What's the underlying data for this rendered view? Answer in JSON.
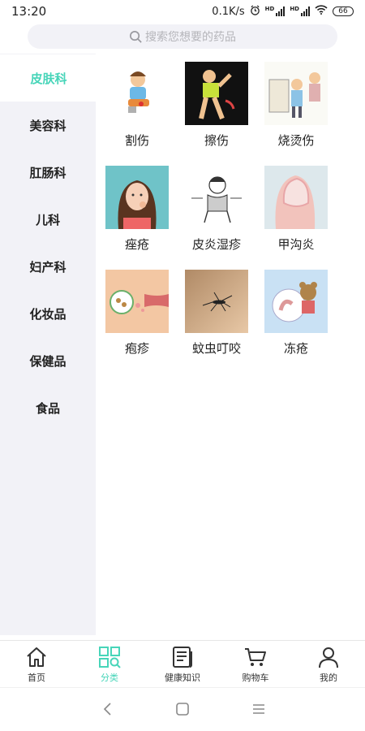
{
  "status_bar": {
    "time": "13:20",
    "network_speed": "0.1K/s",
    "hd_label": "HD",
    "battery": "66"
  },
  "search": {
    "placeholder": "搜索您想要的药品"
  },
  "sidebar": {
    "items": [
      {
        "label": "皮肤科",
        "active": true
      },
      {
        "label": "美容科",
        "active": false
      },
      {
        "label": "肛肠科",
        "active": false
      },
      {
        "label": "儿科",
        "active": false
      },
      {
        "label": "妇产科",
        "active": false
      },
      {
        "label": "化妆品",
        "active": false
      },
      {
        "label": "保健品",
        "active": false
      },
      {
        "label": "食品",
        "active": false
      }
    ]
  },
  "categories": [
    {
      "label": "割伤",
      "icon": "cut-wound-image"
    },
    {
      "label": "擦伤",
      "icon": "abrasion-image"
    },
    {
      "label": "烧烫伤",
      "icon": "burn-image"
    },
    {
      "label": "痤疮",
      "icon": "acne-image"
    },
    {
      "label": "皮炎湿疹",
      "icon": "eczema-image"
    },
    {
      "label": "甲沟炎",
      "icon": "paronychia-image"
    },
    {
      "label": "疱疹",
      "icon": "herpes-image"
    },
    {
      "label": "蚊虫叮咬",
      "icon": "mosquito-bite-image"
    },
    {
      "label": "冻疮",
      "icon": "chilblain-image"
    }
  ],
  "tabbar": {
    "items": [
      {
        "label": "首页",
        "icon": "home-icon",
        "active": false
      },
      {
        "label": "分类",
        "icon": "category-icon",
        "active": true
      },
      {
        "label": "健康知识",
        "icon": "article-icon",
        "active": false
      },
      {
        "label": "购物车",
        "icon": "cart-icon",
        "active": false
      },
      {
        "label": "我的",
        "icon": "profile-icon",
        "active": false
      }
    ]
  },
  "colors": {
    "accent": "#47d5b9",
    "sidebar_bg": "#f2f2f7",
    "search_bg": "#f2f2f7",
    "text": "#222222"
  }
}
